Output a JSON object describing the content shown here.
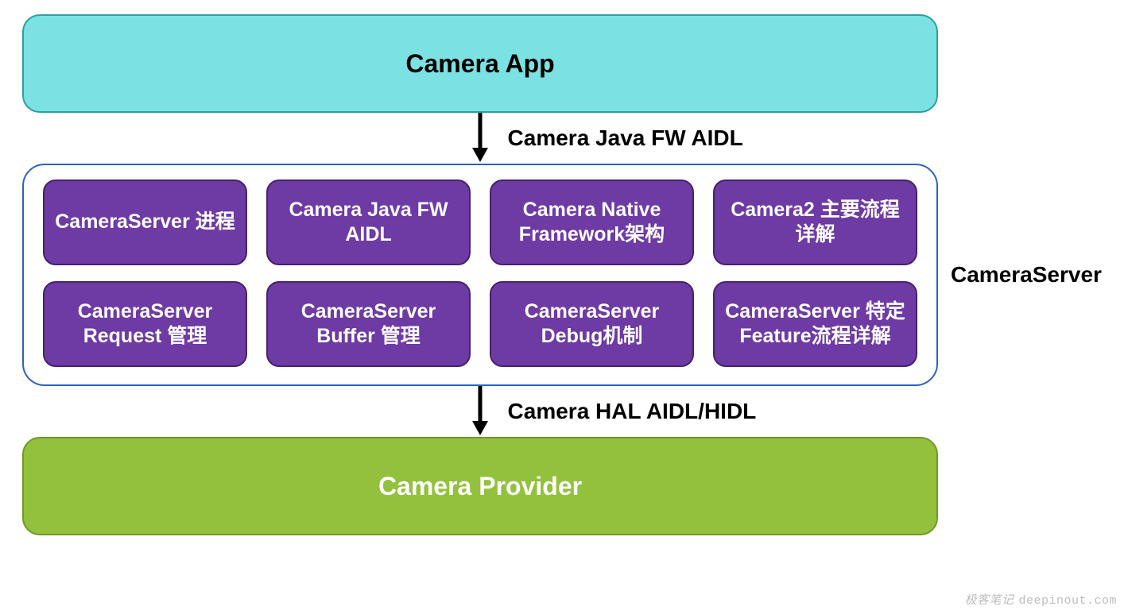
{
  "top": {
    "title": "Camera App"
  },
  "arrows": {
    "top_label": "Camera Java FW AIDL",
    "bottom_label": "Camera HAL AIDL/HIDL"
  },
  "server": {
    "label": "CameraServer",
    "nodes": [
      "CameraServer 进程",
      "Camera Java FW AIDL",
      "Camera Native Framework架构",
      "Camera2 主要流程详解",
      "CameraServer Request 管理",
      "CameraServer Buffer 管理",
      "CameraServer Debug机制",
      "CameraServer 特定Feature流程详解"
    ]
  },
  "bottom": {
    "title": "Camera Provider"
  },
  "watermark": {
    "cn": "极客笔记",
    "en": "deepinout.com"
  },
  "colors": {
    "top_bg": "#7be1e2",
    "node_bg": "#6e3aa4",
    "server_border": "#2a62c4",
    "bottom_bg": "#93c13d"
  }
}
